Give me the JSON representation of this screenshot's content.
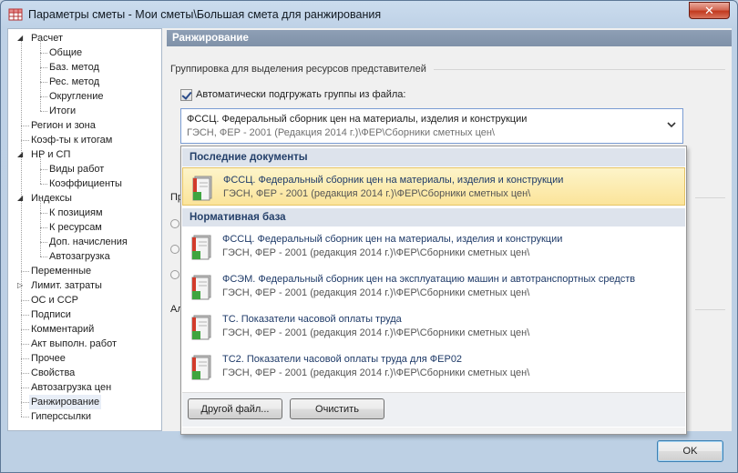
{
  "window": {
    "title": "Параметры сметы - Мои сметы\\Большая смета для ранжирования",
    "close_label": "✕"
  },
  "tree": {
    "items": [
      {
        "label": "Расчет",
        "level": 0,
        "expander": "◢"
      },
      {
        "label": "Общие",
        "level": 1
      },
      {
        "label": "Баз. метод",
        "level": 1
      },
      {
        "label": "Рес. метод",
        "level": 1
      },
      {
        "label": "Округление",
        "level": 1
      },
      {
        "label": "Итоги",
        "level": 1
      },
      {
        "label": "Регион и зона",
        "level": 0
      },
      {
        "label": "Коэф-ты к итогам",
        "level": 0
      },
      {
        "label": "НР и СП",
        "level": 0,
        "expander": "◢"
      },
      {
        "label": "Виды работ",
        "level": 1
      },
      {
        "label": "Коэффициенты",
        "level": 1
      },
      {
        "label": "Индексы",
        "level": 0,
        "expander": "◢"
      },
      {
        "label": "К позициям",
        "level": 1
      },
      {
        "label": "К ресурсам",
        "level": 1
      },
      {
        "label": "Доп. начисления",
        "level": 1
      },
      {
        "label": "Автозагрузка",
        "level": 1
      },
      {
        "label": "Переменные",
        "level": 0
      },
      {
        "label": "Лимит. затраты",
        "level": 0,
        "expander": "▷"
      },
      {
        "label": "ОС и ССР",
        "level": 0
      },
      {
        "label": "Подписи",
        "level": 0
      },
      {
        "label": "Комментарий",
        "level": 0
      },
      {
        "label": "Акт выполн. работ",
        "level": 0
      },
      {
        "label": "Прочее",
        "level": 0
      },
      {
        "label": "Свойства",
        "level": 0
      },
      {
        "label": "Автозагрузка цен",
        "level": 0
      },
      {
        "label": "Ранжирование",
        "level": 0,
        "selected": true
      },
      {
        "label": "Гиперссылки",
        "level": 0
      }
    ]
  },
  "panel": {
    "header": "Ранжирование",
    "group_label": "Группировка для выделения ресурсов представителей",
    "checkbox_label": "Автоматически подгружать группы из файла:",
    "checkbox_checked": true,
    "combo": {
      "line1": "ФССЦ. Федеральный сборник цен на материалы, изделия и конструкции",
      "line2": "ГЭСН, ФЕР - 2001 (Редакция 2014 г.)\\ФЕР\\Сборники сметных цен\\"
    },
    "peek_1": "Пр",
    "peek_2": "Ал"
  },
  "dropdown": {
    "recent_header": "Последние документы",
    "recent_items": [
      {
        "t1": "ФССЦ. Федеральный сборник цен на материалы, изделия и конструкции",
        "t2": "ГЭСН, ФЕР - 2001 (редакция 2014 г.)\\ФЕР\\Сборники сметных цен\\"
      }
    ],
    "base_header": "Нормативная база",
    "base_items": [
      {
        "t1": "ФССЦ. Федеральный сборник цен на материалы, изделия и конструкции",
        "t2": "ГЭСН, ФЕР - 2001 (редакция 2014 г.)\\ФЕР\\Сборники сметных цен\\"
      },
      {
        "t1": "ФСЭМ. Федеральный сборник цен на эксплуатацию машин и автотранспортных средств",
        "t2": "ГЭСН, ФЕР - 2001 (редакция 2014 г.)\\ФЕР\\Сборники сметных цен\\"
      },
      {
        "t1": "ТС. Показатели часовой оплаты труда",
        "t2": "ГЭСН, ФЕР - 2001 (редакция 2014 г.)\\ФЕР\\Сборники сметных цен\\"
      },
      {
        "t1": "ТС2. Показатели часовой оплаты труда для ФЕР02",
        "t2": "ГЭСН, ФЕР - 2001 (редакция 2014 г.)\\ФЕР\\Сборники сметных цен\\"
      }
    ],
    "other_file_button": "Другой файл...",
    "clear_button": "Очистить"
  },
  "footer": {
    "ok_button": "OK"
  },
  "colors": {
    "accent": "#7f91a8",
    "highlight": "#fbe49a",
    "section": "#dde3ec"
  }
}
